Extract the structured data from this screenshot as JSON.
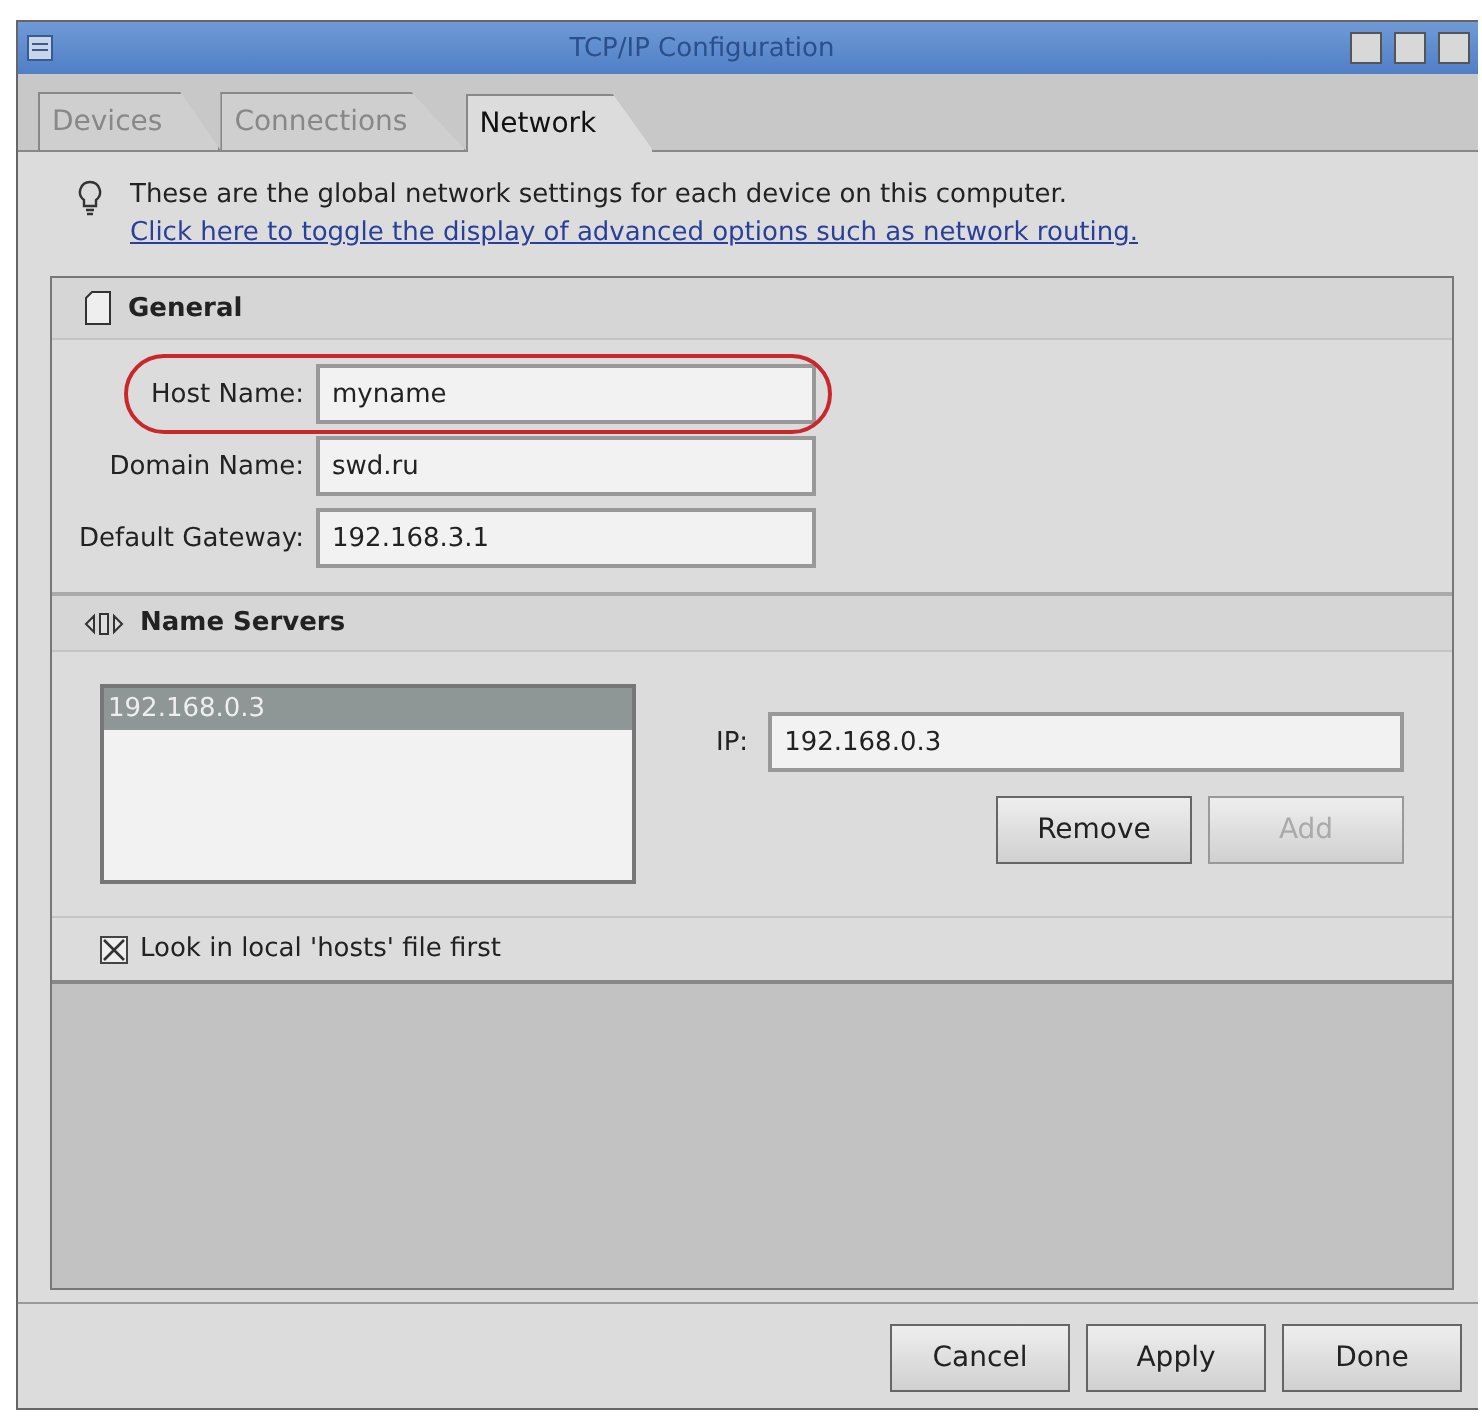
{
  "window": {
    "title": "TCP/IP Configuration"
  },
  "tabs": [
    {
      "label": "Devices",
      "selected": false
    },
    {
      "label": "Connections",
      "selected": false
    },
    {
      "label": "Network",
      "selected": true
    }
  ],
  "info": {
    "text": "These are the global network settings for each device on this computer.",
    "link": "Click here to toggle the display of advanced options such as network routing."
  },
  "general": {
    "title": "General",
    "fields": [
      {
        "label": "Host Name:",
        "value": "myname",
        "highlighted": true
      },
      {
        "label": "Domain Name:",
        "value": "swd.ru",
        "highlighted": false
      },
      {
        "label": "Default Gateway:",
        "value": "192.168.3.1",
        "highlighted": false
      }
    ]
  },
  "name_servers": {
    "title": "Name Servers",
    "list": [
      {
        "text": "192.168.0.3",
        "selected": true
      }
    ],
    "ip_label": "IP:",
    "ip_value": "192.168.0.3",
    "buttons": [
      {
        "label": "Remove",
        "disabled": false
      },
      {
        "label": "Add",
        "disabled": true
      }
    ],
    "hosts_checkbox": {
      "label": "Look in local 'hosts' file first",
      "checked": true
    }
  },
  "buttons": [
    {
      "label": "Cancel"
    },
    {
      "label": "Apply"
    },
    {
      "label": "Done"
    }
  ]
}
